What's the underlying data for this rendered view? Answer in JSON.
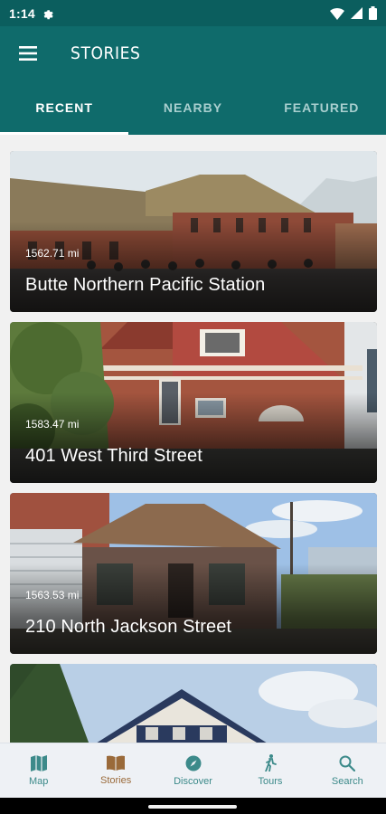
{
  "status_bar": {
    "time": "1:14"
  },
  "app_bar": {
    "title": "STORIES"
  },
  "tabs": [
    {
      "label": "RECENT",
      "active": true
    },
    {
      "label": "NEARBY",
      "active": false
    },
    {
      "label": "FEATURED",
      "active": false
    }
  ],
  "stories": [
    {
      "distance": "1562.71 mi",
      "title": "Butte Northern Pacific Station"
    },
    {
      "distance": "1583.47 mi",
      "title": "401 West Third Street"
    },
    {
      "distance": "1563.53 mi",
      "title": "210 North Jackson Street"
    },
    {
      "distance": "",
      "title": ""
    }
  ],
  "bottom_nav": [
    {
      "label": "Map",
      "icon": "map-icon",
      "active": false
    },
    {
      "label": "Stories",
      "icon": "book-icon",
      "active": true
    },
    {
      "label": "Discover",
      "icon": "compass-icon",
      "active": false
    },
    {
      "label": "Tours",
      "icon": "walking-icon",
      "active": false
    },
    {
      "label": "Search",
      "icon": "search-icon",
      "active": false
    }
  ],
  "colors": {
    "app_bar": "#0f6b6b",
    "status_bar": "#0b5e5e",
    "nav_active": "#9a6a3a",
    "nav_inactive": "#3c8a8a"
  }
}
